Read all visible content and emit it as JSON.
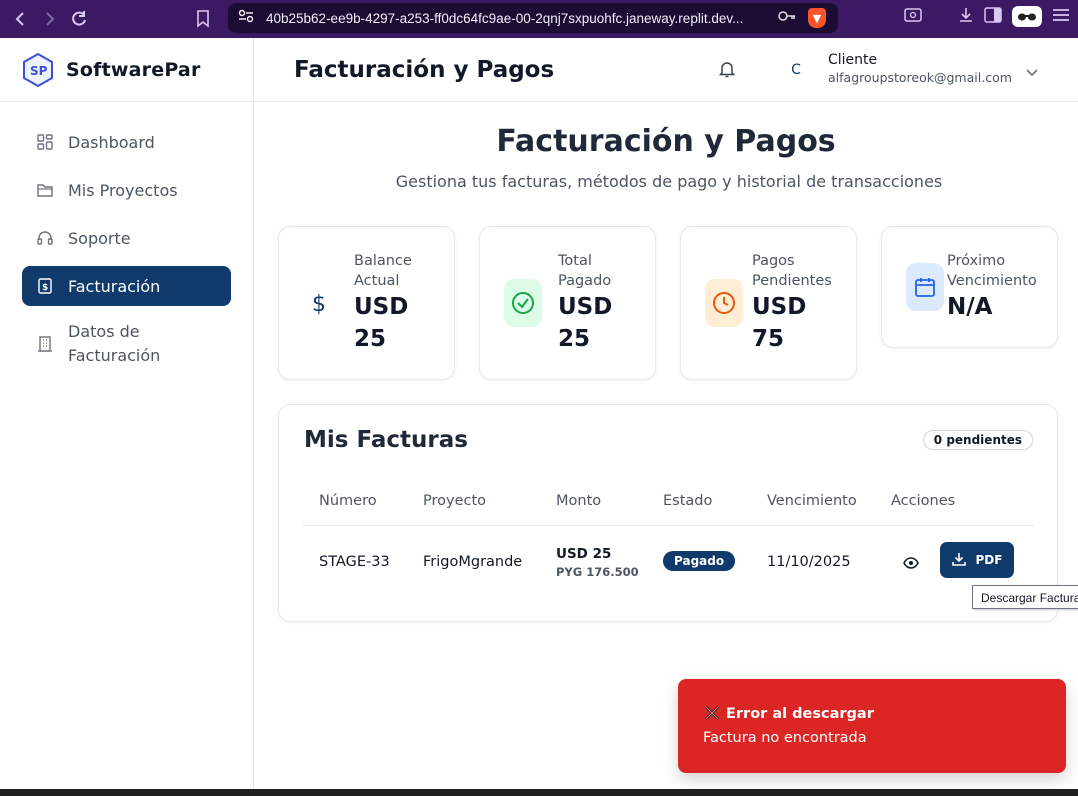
{
  "browser": {
    "url": "40b25b62-ee9b-4297-a253-ff0dc64fc9ae-00-2qnj7sxpuohfc.janeway.replit.dev..."
  },
  "brand": {
    "name": "SoftwarePar"
  },
  "sidebar": {
    "items": [
      {
        "label": "Dashboard",
        "icon": "dashboard-icon"
      },
      {
        "label": "Mis Proyectos",
        "icon": "folder-icon"
      },
      {
        "label": "Soporte",
        "icon": "headset-icon"
      },
      {
        "label": "Facturación",
        "icon": "receipt-icon",
        "active": true
      },
      {
        "label": "Datos de Facturación",
        "icon": "building-icon"
      }
    ]
  },
  "header": {
    "title": "Facturación y Pagos",
    "avatar_initial": "C",
    "user_name": "Cliente",
    "user_email": "alfagroupstoreok@gmail.com"
  },
  "main": {
    "title": "Facturación y Pagos",
    "subtitle": "Gestiona tus facturas, métodos de pago y historial de transacciones"
  },
  "stats": [
    {
      "label": "Balance Actual",
      "value": "USD 25",
      "icon": "dollar-icon",
      "color": "#0f3a6b"
    },
    {
      "label": "Total Pagado",
      "value": "USD 25",
      "icon": "check-circle-icon",
      "color": "#16a34a"
    },
    {
      "label": "Pagos Pendientes",
      "value": "USD 75",
      "icon": "clock-icon",
      "color": "#ea580c"
    },
    {
      "label": "Próximo Vencimiento",
      "value": "N/A",
      "icon": "calendar-icon",
      "color": "#2563eb"
    }
  ],
  "invoices": {
    "title": "Mis Facturas",
    "pending_chip": "0 pendientes",
    "columns": [
      "Número",
      "Proyecto",
      "Monto",
      "Estado",
      "Vencimiento",
      "Acciones"
    ],
    "rows": [
      {
        "number": "STAGE-33",
        "project": "FrigoMgrande",
        "amount": "USD 25",
        "amount_local": "PYG 176.500",
        "status": "Pagado",
        "due": "11/10/2025",
        "pdf_label": "PDF"
      }
    ]
  },
  "tooltip": "Descargar Factura",
  "toast": {
    "title": "Error al descargar",
    "message": "Factura no encontrada",
    "color": "#dc2626"
  }
}
